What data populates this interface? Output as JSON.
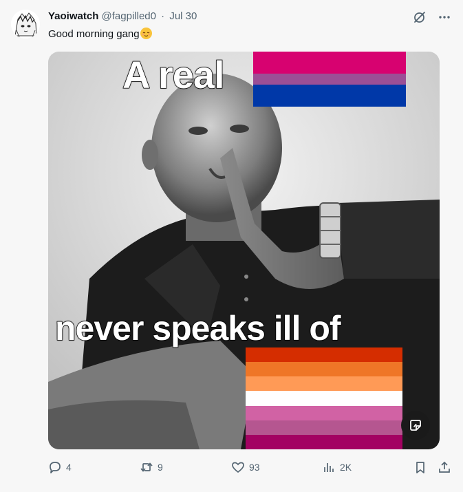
{
  "tweet": {
    "display_name": "Yaoiwatch",
    "handle": "@fagpilled0",
    "separator": "·",
    "date": "Jul 30",
    "text": "Good morning gang",
    "emoji": "relieved-face"
  },
  "media": {
    "top_text": "A real",
    "bottom_text": "never speaks ill of",
    "bi_flag_colors": [
      "#d70270",
      "#9b4f96",
      "#0038a8"
    ],
    "lesbian_flag_colors": [
      "#d52d00",
      "#ef7627",
      "#ff9a56",
      "#ffffff",
      "#d162a4",
      "#b55690",
      "#a30262"
    ]
  },
  "actions": {
    "replies": "4",
    "reposts": "9",
    "likes": "93",
    "views": "2K"
  },
  "colors": {
    "text": "#0f1419",
    "secondary": "#536471"
  }
}
